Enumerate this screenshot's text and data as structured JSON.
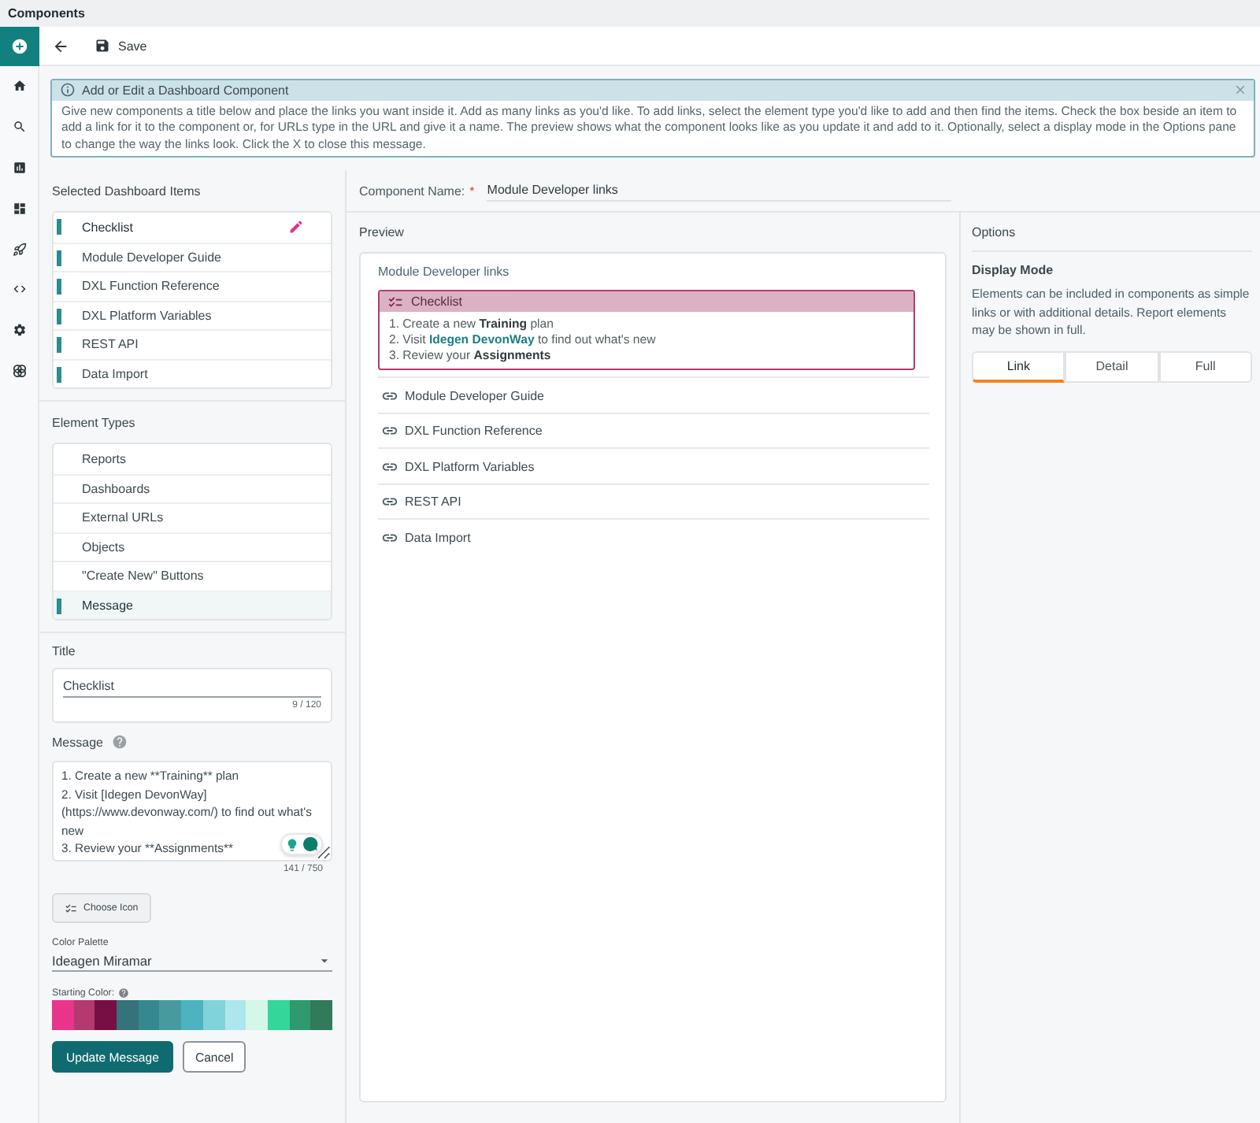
{
  "app": {
    "title": "Components"
  },
  "rail": {
    "items": [
      {
        "selected": true
      },
      {
        "selected": false
      },
      {
        "selected": false
      },
      {
        "selected": false
      },
      {
        "selected": false
      },
      {
        "selected": false
      },
      {
        "selected": false
      },
      {
        "selected": false
      },
      {
        "selected": false
      }
    ]
  },
  "toolbar": {
    "save": "Save"
  },
  "banner": {
    "title": "Add or Edit a Dashboard Component",
    "text": "Give new components a title below and place the links you want inside it. Add as many links as you'd like. To add links, select the element type you'd like to add and then find the items. Check the box beside an item to add a link for it to the component or, for URLs type in the URL and give it a name. The preview shows what the component looks like as you update it and add to it. Optionally, select a display mode in the Options pane to change the way the links look. Click the X to close this message."
  },
  "selected_items": {
    "heading": "Selected Dashboard Items",
    "items": [
      {
        "label": "Checklist",
        "selected": true
      },
      {
        "label": "Module Developer Guide",
        "selected": false
      },
      {
        "label": "DXL Function Reference",
        "selected": false
      },
      {
        "label": "DXL Platform Variables",
        "selected": false
      },
      {
        "label": "REST API",
        "selected": false
      },
      {
        "label": "Data Import",
        "selected": false
      }
    ]
  },
  "element_types": {
    "heading": "Element Types",
    "items": [
      {
        "label": "Reports",
        "selected": false
      },
      {
        "label": "Dashboards",
        "selected": false
      },
      {
        "label": "External URLs",
        "selected": false
      },
      {
        "label": "Objects",
        "selected": false
      },
      {
        "label": "\"Create New\" Buttons",
        "selected": false
      },
      {
        "label": "Message",
        "selected": true
      }
    ]
  },
  "title_field": {
    "label": "Title",
    "value": "Checklist",
    "counter": "9 / 120"
  },
  "message_field": {
    "label": "Message",
    "value": "1. Create a new **Training** plan\n2. Visit [Idegen DevonWay](https://www.devonway.com/) to find out what's new\n3. Review your **Assignments**",
    "counter": "141 / 750"
  },
  "choose_icon": {
    "label": "Choose Icon"
  },
  "color_palette": {
    "label": "Color Palette",
    "value": "Ideagen Miramar"
  },
  "starting_color": {
    "label": "Starting Color:",
    "swatches": [
      {
        "color": "#e8348a"
      },
      {
        "color": "#b3396e"
      },
      {
        "color": "#780f44"
      },
      {
        "color": "#35727a"
      },
      {
        "color": "#36888f"
      },
      {
        "color": "#479b9f"
      },
      {
        "color": "#4db3be"
      },
      {
        "color": "#80d3d9"
      },
      {
        "color": "#ade6ec"
      },
      {
        "color": "#d5f7ea"
      },
      {
        "color": "#35d69a"
      },
      {
        "color": "#2f9970"
      },
      {
        "color": "#317a5a"
      }
    ]
  },
  "actions": [
    {
      "label": "Update Message",
      "kind": "primary"
    },
    {
      "label": "Cancel",
      "kind": "secondary"
    }
  ],
  "component_name": {
    "label": "Component Name:",
    "required_mark": "*",
    "value": "Module Developer links"
  },
  "preview": {
    "heading": "Preview",
    "title": "Module Developer links",
    "message": {
      "title": "Checklist",
      "lines": [
        {
          "text": "1. Create a new **Training** plan"
        },
        {
          "text": "2. Visit ",
          "link": "Idegen DevonWay",
          "after": " to find out what's new"
        },
        {
          "text": "3. Review your **Assignments**"
        }
      ]
    },
    "links": [
      "Module Developer Guide",
      "DXL Function Reference",
      "DXL Platform Variables",
      "REST API",
      "Data Import"
    ]
  },
  "options": {
    "heading": "Options",
    "display_mode": {
      "label": "Display Mode",
      "description": "Elements can be included in components as simple links or with additional details. Report elements may be shown in full.",
      "modes": [
        {
          "label": "Link",
          "selected": true
        },
        {
          "label": "Detail",
          "selected": false
        },
        {
          "label": "Full",
          "selected": false
        }
      ]
    }
  }
}
